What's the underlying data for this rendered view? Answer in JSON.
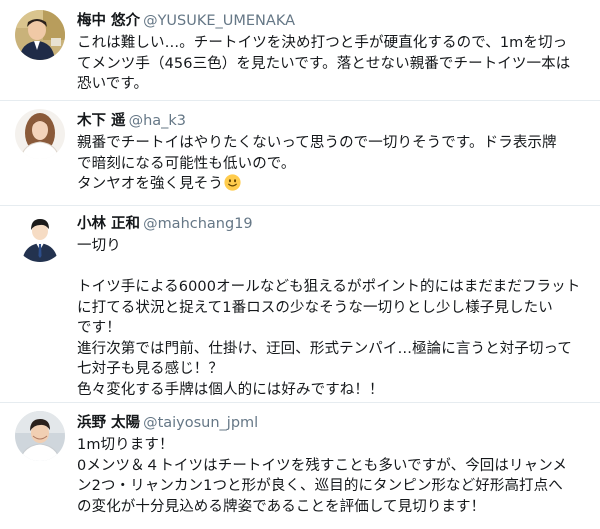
{
  "tweets": [
    {
      "name": "梅中 悠介",
      "handle": "@YUSUKE_UMENAKA",
      "avatar_icon": "avatar-photo-icon",
      "lines": [
        "これは難しい…。チートイツを決め打つと手が硬直化するので、1mを切っ",
        "てメンツ手（456三色）を見たいです。落とせない親番でチートイツ一本は",
        "恐いです。"
      ]
    },
    {
      "name": "木下 遥",
      "handle": "@ha_k3",
      "avatar_icon": "avatar-photo-icon",
      "lines": [
        "親番でチートイはやりたくないって思うので一切りそうです。ドラ表示牌",
        "で暗刻になる可能性も低いので。",
        "タンヤオを強く見そう"
      ],
      "emoji": "smiling-face-emoji"
    },
    {
      "name": "小林 正和",
      "handle": "@mahchang19",
      "avatar_icon": "avatar-illustration-icon",
      "lines": [
        "一切り",
        "",
        "トイツ手による6000オールなども狙えるがポイント的にはまだまだフラット",
        "に打てる状況と捉えて1番ロスの少なそうな一切りとし少し様子見したい",
        "です！",
        "進行次第では門前、仕掛け、迂回、形式テンパイ…極論に言うと対子切って",
        "七対子も見る感じ！？",
        "色々変化する手牌は個人的には好みですね！！"
      ]
    },
    {
      "name": "浜野 太陽",
      "handle": "@taiyosun_jpml",
      "avatar_icon": "avatar-photo-icon",
      "lines": [
        "1m切ります！",
        "0メンツ＆４トイツはチートイツを残すことも多いですが、今回はリャンメ",
        "ン2つ・リャンカン1つと形が良く、巡目的にタンピン形など好形高打点へ",
        "の変化が十分見込める牌姿であることを評価して見切ります！"
      ]
    }
  ],
  "colors": {
    "name": "#14171a",
    "handle": "#657786",
    "separator": "#e6ecf0"
  }
}
